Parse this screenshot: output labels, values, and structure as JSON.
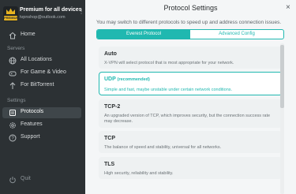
{
  "sidebar": {
    "account": {
      "plan": "Premium for all devices",
      "email": "tvpnshop@outlook.com",
      "badge": "PREMIUM"
    },
    "home": "Home",
    "servers_section": "Servers",
    "all_locations": "All Locations",
    "game_video": "For Game & Video",
    "bittorrent": "For BitTorrent",
    "settings_section": "Settings",
    "protocols": "Protocols",
    "features": "Features",
    "support": "Support",
    "quit": "Quit"
  },
  "main": {
    "title": "Protocol Settings",
    "subtitle": "You may switch to different protocols to speed up and address connection issues.",
    "tabs": [
      "Everest Protocol",
      "Advanced Config"
    ],
    "protocols": [
      {
        "name": "Auto",
        "tag": "",
        "desc": "X-VPN will select protocol that is most appropriate for your network."
      },
      {
        "name": "UDP",
        "tag": "(recommended)",
        "desc": "Simple and fast, maybe unstable under certain network conditions."
      },
      {
        "name": "TCP-2",
        "tag": "",
        "desc": "An upgraded version of TCP, which improves security, but the connection success rate may decrease."
      },
      {
        "name": "TCP",
        "tag": "",
        "desc": "The balance of speed and stability, universal for all networks."
      },
      {
        "name": "TLS",
        "tag": "",
        "desc": "High security, reliability and stability."
      }
    ]
  },
  "colors": {
    "accent": "#20b8b0",
    "sidebar_bg": "#2c3134",
    "main_bg": "#f4f6f7"
  }
}
